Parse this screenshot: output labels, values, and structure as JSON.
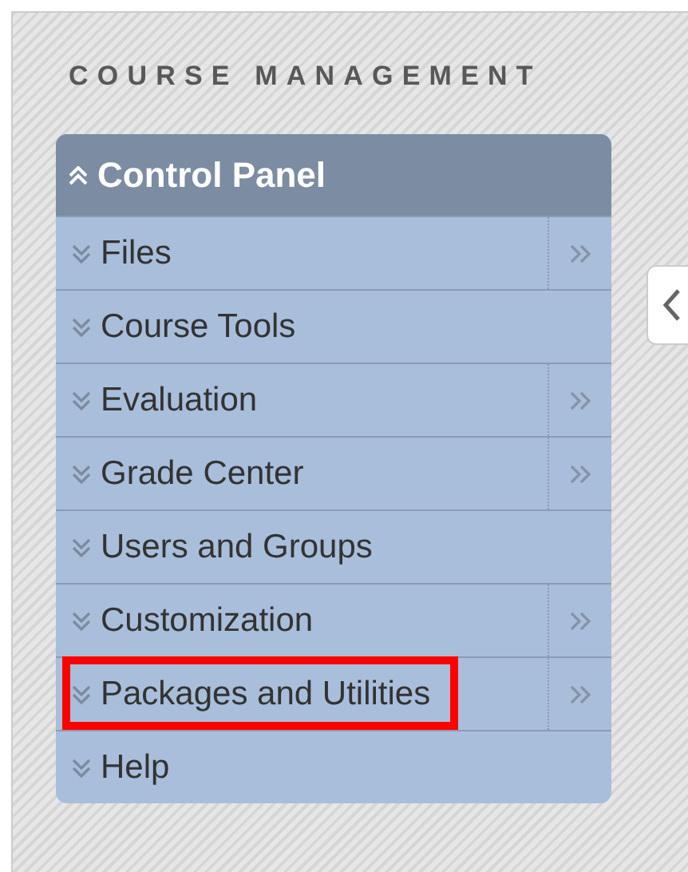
{
  "heading": "COURSE MANAGEMENT",
  "panel": {
    "title": "Control Panel",
    "expanded": true
  },
  "items": [
    {
      "label": "Files",
      "has_submenu": true,
      "highlighted": false
    },
    {
      "label": "Course Tools",
      "has_submenu": false,
      "highlighted": false
    },
    {
      "label": "Evaluation",
      "has_submenu": true,
      "highlighted": false
    },
    {
      "label": "Grade Center",
      "has_submenu": true,
      "highlighted": false
    },
    {
      "label": "Users and Groups",
      "has_submenu": false,
      "highlighted": false
    },
    {
      "label": "Customization",
      "has_submenu": true,
      "highlighted": false
    },
    {
      "label": "Packages and Utilities",
      "has_submenu": true,
      "highlighted": true
    },
    {
      "label": "Help",
      "has_submenu": false,
      "highlighted": false
    }
  ]
}
